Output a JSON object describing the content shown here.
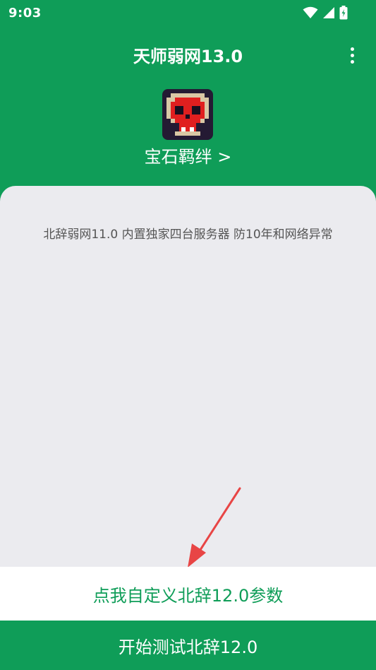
{
  "status_bar": {
    "time": "9:03",
    "icons": [
      "wifi-icon",
      "signal-icon",
      "battery-charging-icon"
    ]
  },
  "app_bar": {
    "title": "天师弱网13.0",
    "menu_icon": "more-vert-icon"
  },
  "profile": {
    "avatar": "pixel-skull-avatar",
    "link_label": "宝石羁绊 >"
  },
  "content": {
    "notice": "北辞弱网11.0 内置独家四台服务器 防10年和网络异常"
  },
  "actions": {
    "custom_params_label": "点我自定义北辞12.0参数",
    "start_label": "开始测试北辞12.0"
  },
  "colors": {
    "primary": "#0f9d58",
    "card_background": "#ebebef",
    "arrow": "#e84545",
    "notice_text": "#555555"
  }
}
